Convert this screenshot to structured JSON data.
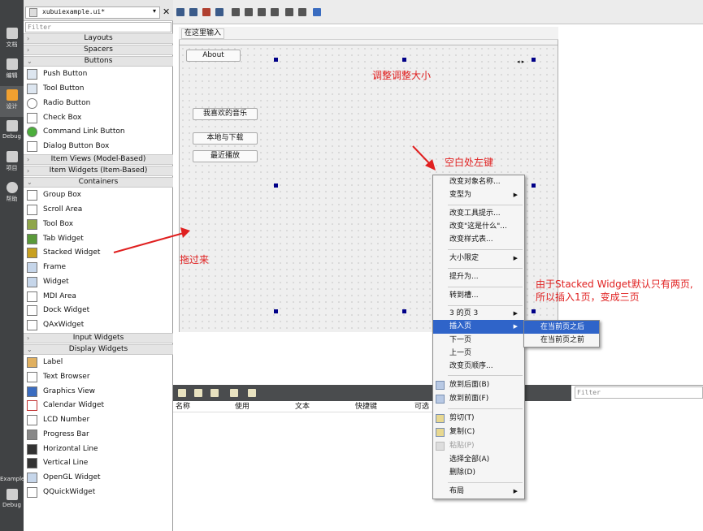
{
  "modes": [
    {
      "label": "文档",
      "icon": "grid-icon"
    },
    {
      "label": "编辑",
      "icon": "edit-icon"
    },
    {
      "label": "设计",
      "icon": "pencil-icon"
    },
    {
      "label": "Debug",
      "icon": "bug-icon"
    },
    {
      "label": "项目",
      "icon": "wrench-icon"
    },
    {
      "label": "帮助",
      "icon": "help-icon"
    }
  ],
  "bottom_modes": [
    {
      "label": "Example",
      "icon": "project-icon"
    },
    {
      "label": "Debug",
      "icon": "monitor-icon"
    }
  ],
  "file_tab": "xubuiexample.ui*",
  "widget_filter_placeholder": "Filter",
  "categories": {
    "layouts": "Layouts",
    "spacers": "Spacers",
    "buttons": "Buttons",
    "item_views": "Item Views (Model-Based)",
    "item_widgets": "Item Widgets (Item-Based)",
    "containers": "Containers",
    "input_widgets": "Input Widgets",
    "display_widgets": "Display Widgets"
  },
  "buttons": [
    "Push Button",
    "Tool Button",
    "Radio Button",
    "Check Box",
    "Command Link Button",
    "Dialog Button Box"
  ],
  "containers": [
    "Group Box",
    "Scroll Area",
    "Tool Box",
    "Tab Widget",
    "Stacked Widget",
    "Frame",
    "Widget",
    "MDI Area",
    "Dock Widget",
    "QAxWidget"
  ],
  "display_widgets": [
    "Label",
    "Text Browser",
    "Graphics View",
    "Calendar Widget",
    "LCD Number",
    "Progress Bar",
    "Horizontal Line",
    "Vertical Line",
    "OpenGL Widget",
    "QQuickWidget"
  ],
  "form": {
    "menu_placeholder": "在这里输入",
    "about": "About",
    "btn1": "我喜欢的音乐",
    "btn2": "本地与下载",
    "btn3": "最近播放"
  },
  "annotations": {
    "resize": "调整调整大小",
    "rightclick": "空白处左键",
    "drag": "拖过来",
    "note1": "由于Stacked Widget默认只有两页,",
    "note2": "所以插入1页，变成三页"
  },
  "actions_header": [
    "名称",
    "使用",
    "文本",
    "快捷键",
    "可选"
  ],
  "right_filter_placeholder": "Filter",
  "context_menu": [
    "改变对象名称...",
    "变型为",
    "改变工具提示...",
    "改变\"这是什么\"...",
    "改变样式表...",
    "大小限定",
    "提升为...",
    "转到槽...",
    "3 的页 3",
    "插入页",
    "下一页",
    "上一页",
    "改变页顺序...",
    "放到后面(B)",
    "放到前面(F)",
    "剪切(T)",
    "复制(C)",
    "粘贴(P)",
    "选择全部(A)",
    "删除(D)",
    "布局"
  ],
  "submenu": [
    "在当前页之后",
    "在当前页之前"
  ],
  "colors": {
    "annotation": "#e02020",
    "highlight": "#2f64c9",
    "modebar": "#404244"
  }
}
